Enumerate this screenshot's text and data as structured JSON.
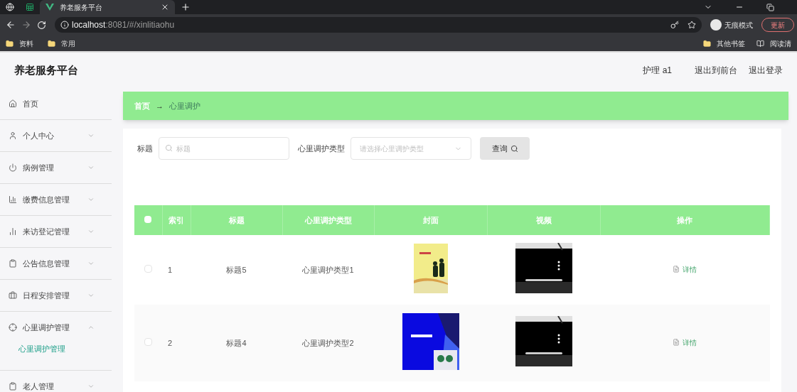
{
  "browser": {
    "tabs": [
      {
        "kind": "icon",
        "selected": false
      },
      {
        "kind": "icon",
        "selected": false
      },
      {
        "kind": "page",
        "title": "养老服务平台",
        "selected": true
      }
    ],
    "address": {
      "host": "localhost",
      "path": ":8081/#/xinlitiaohu"
    },
    "incognito": "无痕模式",
    "update": "更新",
    "bookmarks": [
      "资料",
      "常用"
    ],
    "bookmarks_right": [
      "其他书签",
      "阅读清"
    ]
  },
  "header": {
    "title": "养老服务平台",
    "user": "护理 a1",
    "links": [
      "退出到前台",
      "退出登录"
    ]
  },
  "sidebar": {
    "items": [
      {
        "label": "首页",
        "kind": "link"
      },
      {
        "label": "个人中心",
        "kind": "menu",
        "expanded": false
      },
      {
        "label": "病例管理",
        "kind": "menu",
        "expanded": false
      },
      {
        "label": "缴费信息管理",
        "kind": "menu",
        "expanded": false
      },
      {
        "label": "来访登记管理",
        "kind": "menu",
        "expanded": false
      },
      {
        "label": "公告信息管理",
        "kind": "menu",
        "expanded": false
      },
      {
        "label": "日程安排管理",
        "kind": "menu",
        "expanded": false
      },
      {
        "label": "心里调护管理",
        "kind": "menu",
        "expanded": true,
        "children": [
          {
            "label": "心里调护管理",
            "selected": true
          }
        ]
      },
      {
        "label": "老人管理",
        "kind": "menu",
        "expanded": false
      }
    ]
  },
  "breadcrumb": {
    "items": [
      "首页",
      "心里调护"
    ],
    "separator": "→"
  },
  "search": {
    "fields": [
      {
        "label": "标题",
        "kind": "text",
        "placeholder": "标题"
      },
      {
        "label": "心里调护类型",
        "kind": "select",
        "placeholder": "请选择心里调护类型"
      }
    ],
    "button": "查询"
  },
  "table": {
    "all_checked": false,
    "columns": [
      "索引",
      "标题",
      "心里调护类型",
      "封面",
      "视频",
      "操作"
    ],
    "rows": [
      {
        "checked": false,
        "index": "1",
        "title": "标题5",
        "type": "心里调护类型1",
        "action": "详情"
      },
      {
        "checked": false,
        "index": "2",
        "title": "标题4",
        "type": "心里调护类型2",
        "action": "详情"
      }
    ]
  }
}
